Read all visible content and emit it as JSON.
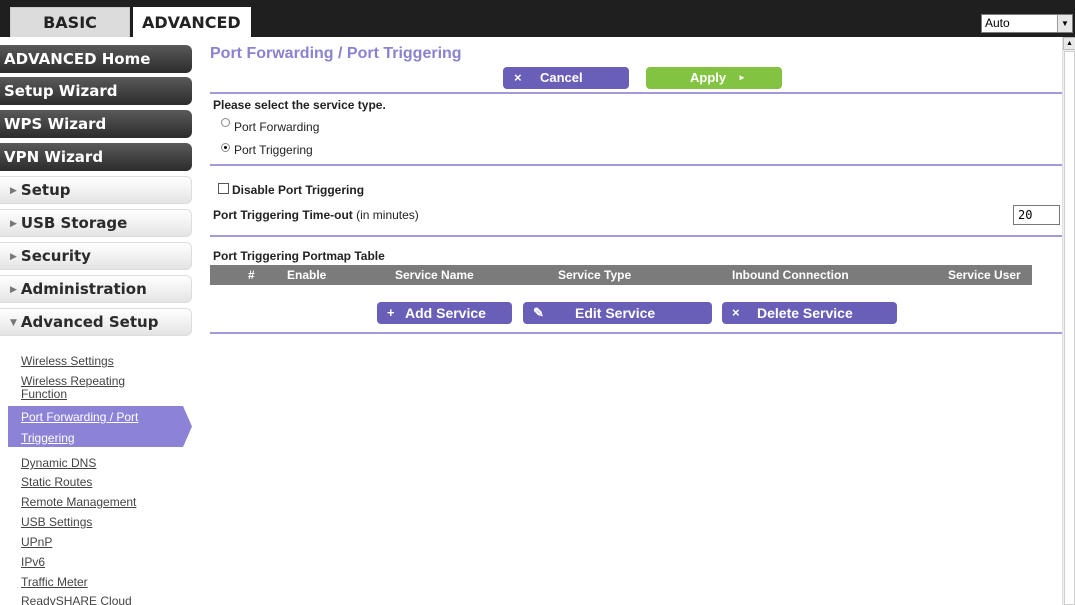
{
  "tabs": {
    "basic": "BASIC",
    "advanced": "ADVANCED"
  },
  "language_select": {
    "value": "Auto"
  },
  "sidebar": {
    "dark_buttons": [
      "ADVANCED Home",
      "Setup Wizard",
      "WPS Wizard",
      "VPN Wizard"
    ],
    "sections": [
      "Setup",
      "USB Storage",
      "Security",
      "Administration",
      "Advanced Setup"
    ],
    "sub_links": {
      "wireless_settings": "Wireless Settings",
      "wireless_repeating_1": "Wireless Repeating",
      "wireless_repeating_2": "Function",
      "port_fwd_1": "Port Forwarding / Port",
      "port_fwd_2": "Triggering",
      "dynamic_dns": "Dynamic DNS",
      "static_routes": "Static Routes",
      "remote_management": "Remote Management",
      "usb_settings": "USB Settings",
      "upnp": "UPnP",
      "ipv6": "IPv6",
      "traffic_meter": "Traffic Meter",
      "readyshare_cloud": "ReadySHARE Cloud"
    }
  },
  "main": {
    "title": "Port Forwarding / Port Triggering",
    "cancel_label": "Cancel",
    "cancel_icon": "×",
    "apply_label": "Apply",
    "apply_icon": "►",
    "service_type_prompt": "Please select the service type.",
    "radio_forwarding": "Port Forwarding",
    "radio_triggering": "Port Triggering",
    "selected_service_type": "Port Triggering",
    "disable_label": "Disable Port Triggering",
    "disable_checked": false,
    "timeout_label_bold": "Port Triggering Time-out",
    "timeout_label_rest": " (in minutes)",
    "timeout_value": "20",
    "table_title": "Port Triggering Portmap Table",
    "columns": [
      "#",
      "Enable",
      "Service Name",
      "Service Type",
      "Inbound Connection",
      "Service User"
    ],
    "add_service": "Add Service",
    "add_icon": "+",
    "edit_service": "Edit Service",
    "edit_icon": "✎",
    "delete_service": "Delete Service",
    "delete_icon": "×"
  }
}
